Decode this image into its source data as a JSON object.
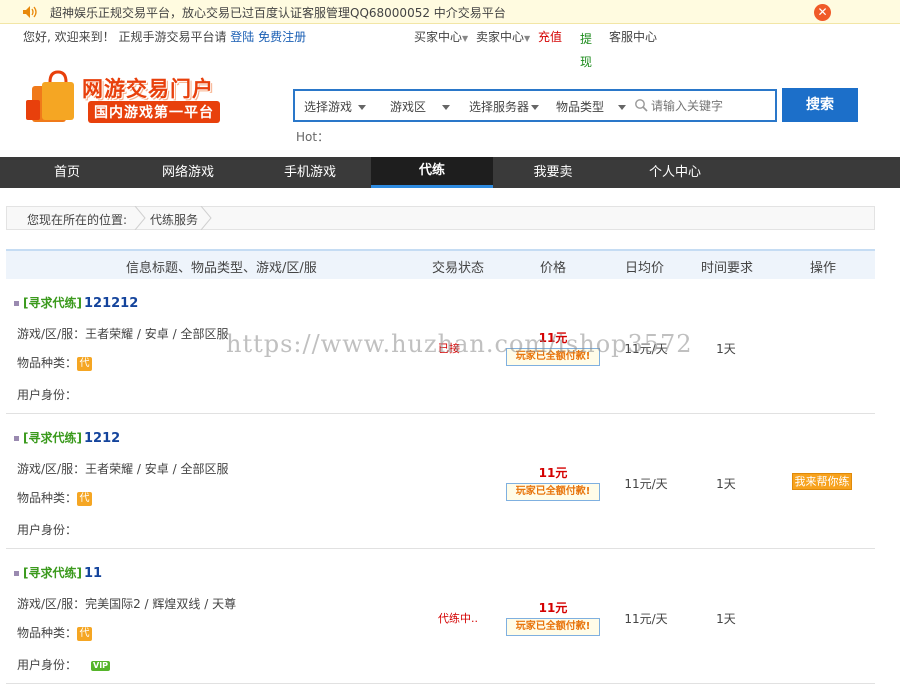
{
  "notice": {
    "text": "超神娱乐正规交易平台，放心交易已过百度认证客服管理QQ68000052 中介交易平台",
    "close": "✕"
  },
  "toplinks": {
    "welcome": "您好, 欢迎来到！ 正规手游交易平台请",
    "login": "登陆",
    "register": "免费注册",
    "buyer": "买家中心",
    "seller": "卖家中心",
    "recharge": "充值",
    "withdraw": "提现",
    "service": "客服中心"
  },
  "logo": {
    "title": "网游交易门户",
    "subtitle": "国内游戏第一平台"
  },
  "search": {
    "selects": [
      "选择游戏",
      "游戏区",
      "选择服务器",
      "物品类型"
    ],
    "placeholder": "请输入关键字",
    "button": "搜索",
    "hot": "Hot："
  },
  "nav": [
    "首页",
    "网络游戏",
    "手机游戏",
    "代练",
    "我要卖",
    "个人中心"
  ],
  "breadcrumb": {
    "location": "您现在所在的位置:",
    "current": "代练服务"
  },
  "table": {
    "headers": [
      "信息标题、物品类型、游戏/区/服",
      "交易状态",
      "价格",
      "日均价",
      "时间要求",
      "操作"
    ],
    "labels": {
      "game": "游戏/区/服：",
      "type": "物品种类：",
      "identity": "用户身份：",
      "type_icon": "代",
      "paid": "玩家已全额付款!",
      "vip": "VIP"
    },
    "rows": [
      {
        "tag": "[寻求代练]",
        "name": "121212",
        "game": "王者荣耀 / 安卓 / 全部区服",
        "status": "已接",
        "price": "11元",
        "avg": "11元/天",
        "time": "1天",
        "op": "",
        "vip": false
      },
      {
        "tag": "[寻求代练]",
        "name": "1212",
        "game": "王者荣耀 / 安卓 / 全部区服",
        "status": "",
        "price": "11元",
        "avg": "11元/天",
        "time": "1天",
        "op": "我来帮你练",
        "vip": false
      },
      {
        "tag": "[寻求代练]",
        "name": "11",
        "game": "完美国际2 / 辉煌双线 / 天尊",
        "status": "代练中..",
        "price": "11元",
        "avg": "11元/天",
        "time": "1天",
        "op": "",
        "vip": true
      }
    ]
  },
  "watermark": "https://www.huzhan.com/ishop3572",
  "colors": {
    "accent": "#1c6fc9",
    "price": "#d40000",
    "tag": "#3a9a1c",
    "nav_bg": "#3a3a3a"
  }
}
